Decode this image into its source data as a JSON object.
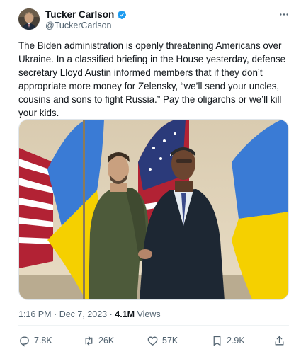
{
  "author": {
    "display_name": "Tucker Carlson",
    "handle": "@TuckerCarlson",
    "verified_icon": "verified-badge-icon",
    "avatar_icon": "avatar"
  },
  "tweet": {
    "text": "The Biden administration is openly threatening Americans over Ukraine. In a classified briefing in the House yesterday, defense secretary Lloyd Austin informed members that if they don’t appropriate more money for Zelensky, “we’ll send your uncles, cousins and sons to fight Russia.” Pay the oligarchs or we’ll kill your kids."
  },
  "meta": {
    "time": "1:16 PM",
    "separator": "·",
    "date": "Dec 7, 2023",
    "views_count": "4.1M",
    "views_label": "Views"
  },
  "actions": {
    "replies": "7.8K",
    "reposts": "26K",
    "likes": "57K",
    "bookmarks": "2.9K"
  },
  "colors": {
    "text_primary": "#0f1419",
    "text_secondary": "#536471",
    "verified_blue": "#1d9bf0",
    "ukraine_blue": "#3a7bd5",
    "ukraine_yellow": "#f5d000"
  }
}
